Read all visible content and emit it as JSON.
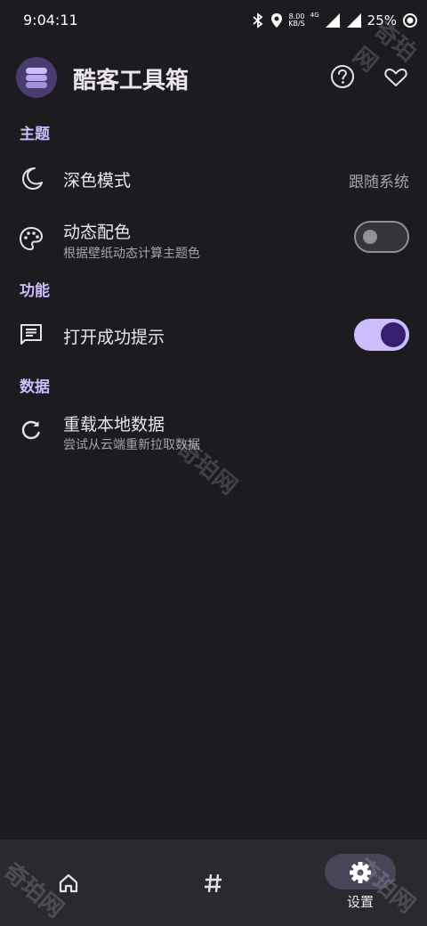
{
  "status_bar": {
    "time": "9:04:11",
    "net_speed_value": "8.00",
    "net_speed_unit": "KB/S",
    "network_type": "4G",
    "battery": "25%"
  },
  "app_bar": {
    "title": "酷客工具箱",
    "help_icon": "help-circle-icon",
    "favorite_icon": "heart-outline-icon"
  },
  "sections": {
    "theme": {
      "title": "主题",
      "dark_mode": {
        "title": "深色模式",
        "value": "跟随系统",
        "icon": "moon-icon"
      },
      "dynamic_color": {
        "title": "动态配色",
        "subtitle": "根据壁纸动态计算主题色",
        "enabled": false,
        "icon": "palette-icon"
      }
    },
    "features": {
      "title": "功能",
      "open_success_tip": {
        "title": "打开成功提示",
        "enabled": true,
        "icon": "message-icon"
      }
    },
    "data": {
      "title": "数据",
      "reload": {
        "title": "重载本地数据",
        "subtitle": "尝试从云端重新拉取数据",
        "icon": "refresh-icon"
      }
    }
  },
  "bottom_nav": {
    "items": [
      {
        "icon": "home-icon",
        "label": ""
      },
      {
        "icon": "hash-icon",
        "label": ""
      },
      {
        "icon": "gear-icon",
        "label": "设置",
        "selected": true
      }
    ]
  },
  "watermark": "奇珀网",
  "colors": {
    "background": "#1c1b1f",
    "accent": "#cdbdff",
    "switch_on_knob": "#381e72",
    "nav_bar": "#2a2930",
    "nav_active_pill": "#4a4458"
  }
}
